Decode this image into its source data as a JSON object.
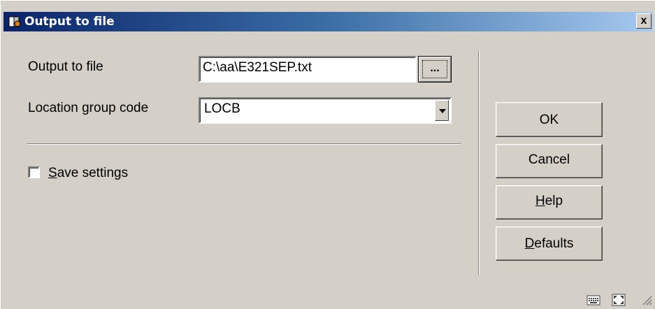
{
  "window": {
    "title": "Output to file",
    "close_label": "x"
  },
  "form": {
    "output_label": "Output to file",
    "output_value": "C:\\aa\\E321SEP.txt",
    "browse_label": "...",
    "location_label": "Location group code",
    "location_value": "LOCB"
  },
  "save_settings": {
    "mnemonic": "S",
    "rest": "ave settings",
    "checked": false
  },
  "buttons": {
    "ok": "OK",
    "cancel": "Cancel",
    "help_mnemonic": "H",
    "help_rest": "elp",
    "defaults_mnemonic": "D",
    "defaults_rest": "efaults"
  },
  "icons": [
    "keyboard-icon",
    "resize-icon",
    "size-grip-icon"
  ]
}
